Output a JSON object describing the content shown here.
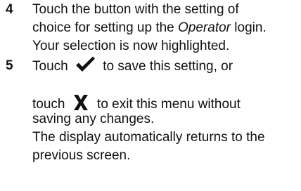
{
  "steps": [
    {
      "number": "4",
      "line1": "Touch the button with the setting of",
      "line2": "choice for setting up the ",
      "line2_italic": "Operator",
      "line2_end": " login.",
      "line3": "Your selection is now highlighted."
    },
    {
      "number": "5",
      "line1_start": "Touch",
      "line1_end": "to save this setting, or",
      "line2_start": "touch",
      "line2_end": "to exit this menu without",
      "line3": "saving any changes.",
      "line4": "The display automatically returns to the",
      "line5": "previous screen."
    }
  ],
  "icons": {
    "confirm": "checkmark-icon",
    "cancel": "x-mark-icon"
  }
}
